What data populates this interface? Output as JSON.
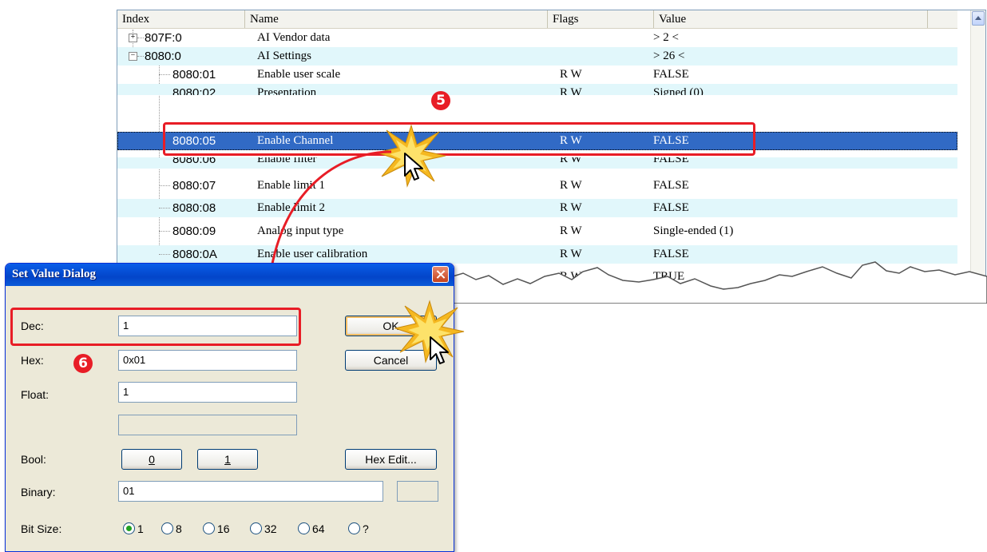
{
  "table": {
    "columns": [
      "Index",
      "Name",
      "Flags",
      "Value"
    ],
    "rows": [
      {
        "index": "807F:0",
        "name": "AI Vendor data",
        "flags": "",
        "value": "> 2 <"
      },
      {
        "index": "8080:0",
        "name": "AI Settings",
        "flags": "",
        "value": "> 26 <"
      },
      {
        "index": "8080:01",
        "name": "Enable user scale",
        "flags": "R W",
        "value": "FALSE"
      },
      {
        "index": "8080:02",
        "name": "Presentation",
        "flags": "R W",
        "value": "Signed (0)"
      },
      {
        "index": "8080:05",
        "name": "Enable Channel",
        "flags": "R W",
        "value": "FALSE"
      },
      {
        "index": "8080:06",
        "name": "Enable filter",
        "flags": "R W",
        "value": "FALSE"
      },
      {
        "index": "8080:07",
        "name": "Enable limit 1",
        "flags": "R W",
        "value": "FALSE"
      },
      {
        "index": "8080:08",
        "name": "Enable limit 2",
        "flags": "R W",
        "value": "FALSE"
      },
      {
        "index": "8080:09",
        "name": "Analog input type",
        "flags": "R W",
        "value": "Single-ended (1)"
      },
      {
        "index": "8080:0A",
        "name": "Enable user calibration",
        "flags": "R W",
        "value": "FALSE"
      },
      {
        "index": "",
        "name": "",
        "flags": "R W",
        "value": "TRUE"
      }
    ]
  },
  "annotations": {
    "step5": "5",
    "step6": "6"
  },
  "dialog": {
    "title": "Set Value Dialog",
    "dec_label": "Dec:",
    "dec_value": "1",
    "hex_label": "Hex:",
    "hex_value": "0x01",
    "float_label": "Float:",
    "float_value": "1",
    "extra_value": "",
    "bool_label": "Bool:",
    "bool_0": "0",
    "bool_1": "1",
    "binary_label": "Binary:",
    "binary_value": "01",
    "bitsize_label": "Bit Size:",
    "bitsize_options": [
      "1",
      "8",
      "16",
      "32",
      "64",
      "?"
    ],
    "ok": "OK",
    "cancel": "Cancel",
    "hex_edit": "Hex Edit..."
  },
  "colors": {
    "accent_red": "#e81d26",
    "selection": "#316ac5",
    "alt_row": "#e1f7fb"
  }
}
